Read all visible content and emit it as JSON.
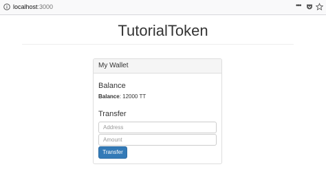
{
  "browser": {
    "url_host": "localhost",
    "url_port": ":3000",
    "icons": [
      "info-icon",
      "more-options-icon",
      "pocket-icon",
      "bookmark-star-icon"
    ]
  },
  "page": {
    "title": "TutorialToken"
  },
  "wallet": {
    "heading": "My Wallet",
    "balance_heading": "Balance",
    "balance_label": "Balance",
    "balance_value": ": 12000 TT",
    "transfer_heading": "Transfer",
    "address_placeholder": "Address",
    "amount_placeholder": "Amount",
    "transfer_button": "Transfer"
  },
  "colors": {
    "primary_button": "#337ab7",
    "panel_heading_bg": "#f5f5f5",
    "border": "#dddddd"
  }
}
